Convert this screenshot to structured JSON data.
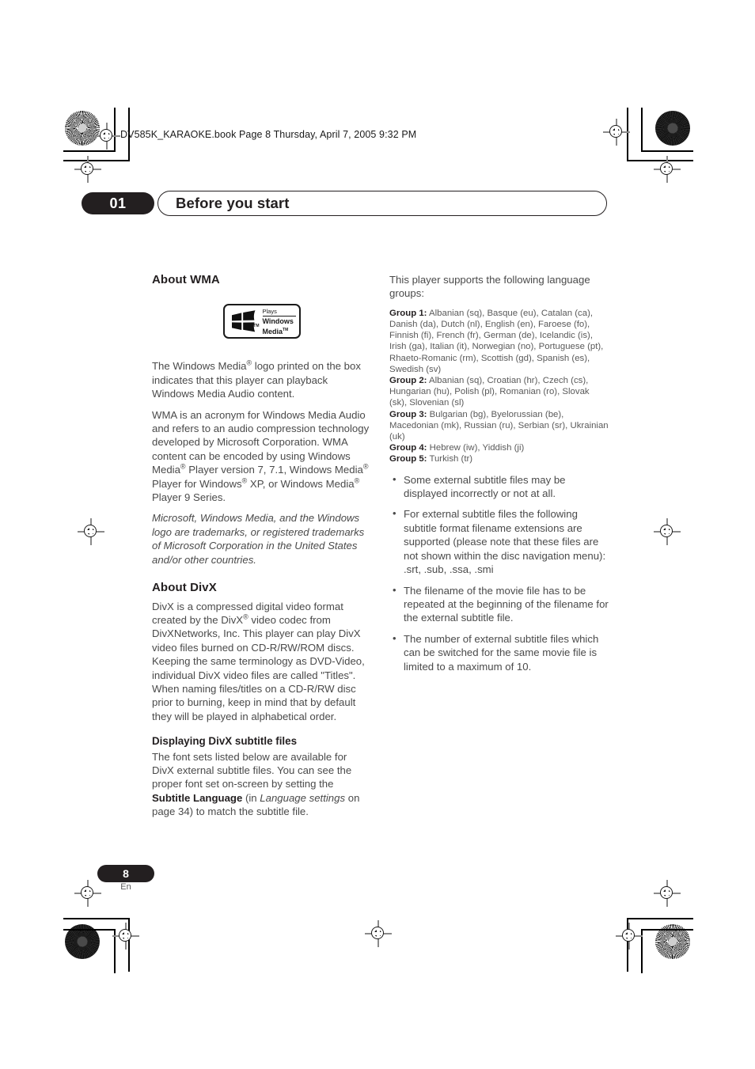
{
  "file_header": "DV585K_KARAOKE.book  Page 8  Thursday, April 7, 2005  9:32 PM",
  "chapter": {
    "number": "01",
    "title": "Before you start"
  },
  "left_column": {
    "wma_heading": "About WMA",
    "logo": {
      "plays": "Plays",
      "windows": "Windows",
      "media": "Media",
      "tm": "TM",
      "flag_tm": "TM"
    },
    "wma_p1_a": "The Windows Media",
    "wma_p1_b": " logo printed on the box indicates that this player can playback Windows Media Audio content.",
    "wma_p2_a": "WMA is an acronym for Windows Media Audio and refers to an audio compression technology developed by Microsoft Corporation. WMA content can be encoded by using Windows Media",
    "wma_p2_b": " Player version 7, 7.1, Windows Media",
    "wma_p2_c": " Player for Windows",
    "wma_p2_d": " XP, or Windows Media",
    "wma_p2_e": " Player 9 Series.",
    "wma_trademark": "Microsoft, Windows Media, and the Windows logo are trademarks, or registered trademarks of Microsoft Corporation in the United States and/or other countries.",
    "divx_heading": "About DivX",
    "divx_p1_a": "DivX is a compressed digital video format created by the DivX",
    "divx_p1_b": " video codec from DivXNetworks, Inc. This player can play DivX video files burned on CD-R/RW/ROM discs. Keeping the same terminology as DVD-Video, individual DivX video files are called \"Titles\". When naming files/titles on a CD-R/RW disc prior to burning, keep in mind that by default they will be played in alphabetical order.",
    "subtitle_heading": "Displaying DivX subtitle files",
    "subtitle_p_a": "The font sets listed below are available for DivX external subtitle files. You can see the proper font set on-screen by setting the ",
    "subtitle_p_bold1": "Subtitle Language",
    "subtitle_p_b": " (in ",
    "subtitle_p_italic": "Language settings",
    "subtitle_p_c": " on page 34) to match the subtitle file."
  },
  "right_column": {
    "intro": "This player supports the following language groups:",
    "groups": [
      {
        "label": "Group 1:",
        "languages": "Albanian (sq), Basque (eu), Catalan (ca), Danish (da), Dutch (nl), English (en), Faroese (fo), Finnish (fi), French (fr), German (de), Icelandic (is), Irish (ga), Italian (it), Norwegian (no), Portuguese (pt), Rhaeto-Romanic (rm), Scottish (gd), Spanish (es), Swedish (sv)"
      },
      {
        "label": "Group 2:",
        "languages": "Albanian (sq), Croatian (hr), Czech (cs), Hungarian (hu), Polish (pl), Romanian (ro), Slovak (sk), Slovenian (sl)"
      },
      {
        "label": "Group 3:",
        "languages": "Bulgarian (bg), Byelorussian (be), Macedonian (mk), Russian (ru), Serbian (sr), Ukrainian (uk)"
      },
      {
        "label": "Group 4:",
        "languages": "Hebrew (iw), Yiddish (ji)"
      },
      {
        "label": "Group 5:",
        "languages": "Turkish (tr)"
      }
    ],
    "bullets": [
      "Some external subtitle files may be displayed incorrectly or not at all.",
      "For external subtitle files the following subtitle format filename extensions are supported (please note that these files are not shown within the disc navigation menu): .srt, .sub, .ssa, .smi",
      "The filename of the movie file has to be repeated at the beginning of the filename for the external subtitle file.",
      "The number of external subtitle files which can be switched for the same movie file is limited to a maximum of 10."
    ]
  },
  "footer": {
    "page_number": "8",
    "language_code": "En"
  },
  "symbols": {
    "registered": "®"
  }
}
